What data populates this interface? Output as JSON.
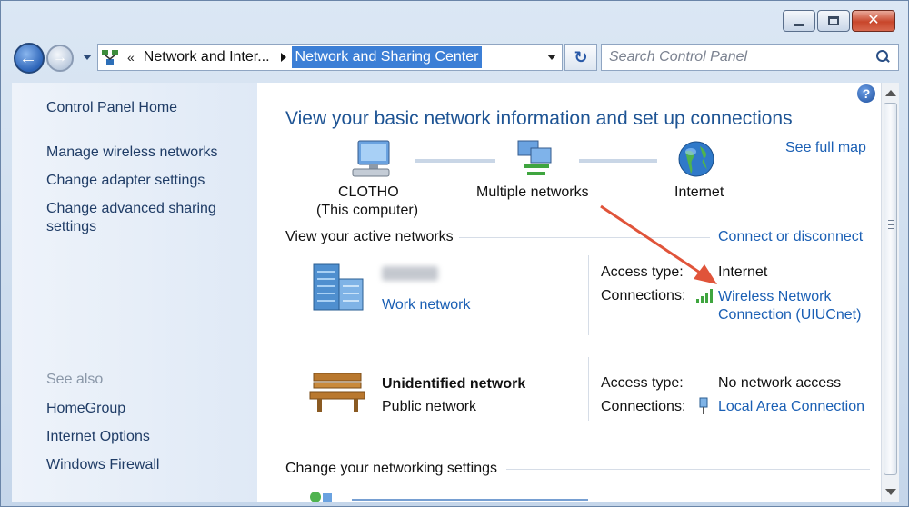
{
  "breadcrumb": {
    "parent": "Network and Inter...",
    "current": "Network and Sharing Center"
  },
  "search": {
    "placeholder": "Search Control Panel"
  },
  "sidebar": {
    "home": "Control Panel Home",
    "tasks": [
      "Manage wireless networks",
      "Change adapter settings",
      "Change advanced sharing settings"
    ],
    "see_also_label": "See also",
    "see_also": [
      "HomeGroup",
      "Internet Options",
      "Windows Firewall"
    ]
  },
  "main": {
    "heading": "View your basic network information and set up connections",
    "see_full_map": "See full map",
    "map": {
      "computer_name": "CLOTHO",
      "computer_sub": "(This computer)",
      "networks": "Multiple networks",
      "internet": "Internet"
    },
    "active_networks_title": "View your active networks",
    "connect_or_disconnect": "Connect or disconnect",
    "networks": [
      {
        "type_link": "Work network",
        "access_label": "Access type:",
        "access_value": "Internet",
        "connections_label": "Connections:",
        "connection_link": "Wireless Network Connection (UIUCnet)",
        "connection_line1": "Wireless Network",
        "connection_line2": "Connection (UIUCnet)"
      },
      {
        "name": "Unidentified network",
        "type": "Public network",
        "access_label": "Access type:",
        "access_value": "No network access",
        "connections_label": "Connections:",
        "connection_link": "Local Area Connection"
      }
    ],
    "change_settings_title": "Change your networking settings"
  },
  "colors": {
    "link": "#1a5fb4",
    "heading": "#1e5494",
    "annotation_arrow": "#e0543a"
  }
}
